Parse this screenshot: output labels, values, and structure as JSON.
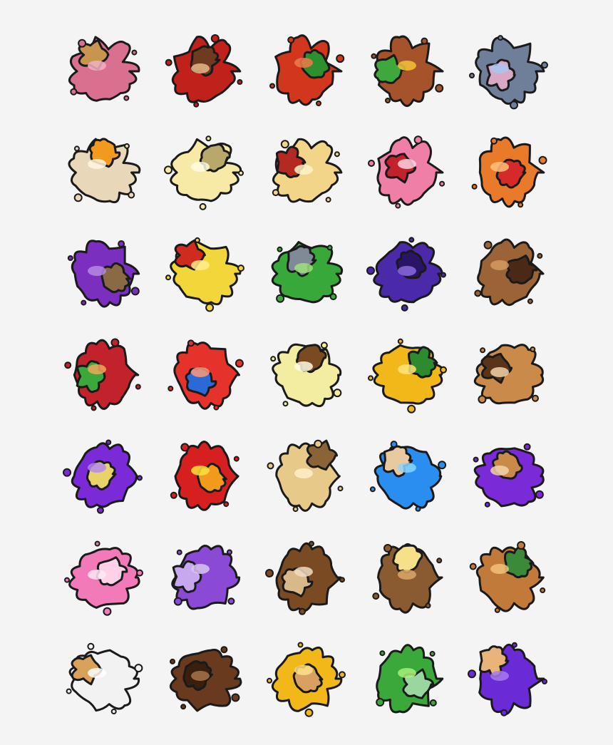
{
  "emotes": [
    {
      "name": "ice-cream-splat-icon",
      "main": "#d9708f",
      "accent": "#c8954e",
      "hl": "#f3b0c3"
    },
    {
      "name": "spaghetti-meatball-splat-icon",
      "main": "#c0211b",
      "accent": "#6e3b1e",
      "hl": "#e8b98a"
    },
    {
      "name": "tomato-splat-icon",
      "main": "#d2371d",
      "accent": "#2e8f2e",
      "hl": "#f07a4a"
    },
    {
      "name": "hamburger-splat-icon",
      "main": "#a6522a",
      "accent": "#3fa83c",
      "hl": "#f6c23a"
    },
    {
      "name": "toaster-jelly-splat-icon",
      "main": "#6f7f9a",
      "accent": "#d9a8c4",
      "hl": "#a9c6ee"
    },
    {
      "name": "cracked-egg-splat-icon",
      "main": "#e8d7b8",
      "accent": "#f29a1d",
      "hl": "#fff6df"
    },
    {
      "name": "popcorn-splat-icon",
      "main": "#f6eaa6",
      "accent": "#b9a86b",
      "hl": "#fffbe0"
    },
    {
      "name": "noodle-bowl-splat-icon",
      "main": "#f3d58a",
      "accent": "#b22a22",
      "hl": "#fff2c7"
    },
    {
      "name": "cake-slice-splat-icon",
      "main": "#ef7fa6",
      "accent": "#c2222b",
      "hl": "#ffd1e1"
    },
    {
      "name": "chips-bag-splat-icon",
      "main": "#e87a2a",
      "accent": "#d42a2a",
      "hl": "#ffc27a"
    },
    {
      "name": "berry-pie-splat-icon",
      "main": "#7b2fbf",
      "accent": "#8a6a45",
      "hl": "#b58ae0"
    },
    {
      "name": "pizza-slice-splat-icon",
      "main": "#f2d63a",
      "accent": "#d12b1f",
      "hl": "#fff08a"
    },
    {
      "name": "salad-plate-splat-icon",
      "main": "#39a83a",
      "accent": "#7f8a96",
      "hl": "#9fe07a"
    },
    {
      "name": "blackberry-splat-icon",
      "main": "#4a2aa8",
      "accent": "#2a1466",
      "hl": "#8a6ae0"
    },
    {
      "name": "cookie-crumbs-icon",
      "main": "#9a6436",
      "accent": "#4a2a16",
      "hl": "#d39a62"
    },
    {
      "name": "fruit-bowl-splat-icon",
      "main": "#c2222b",
      "accent": "#3aa83a",
      "hl": "#f2a85a"
    },
    {
      "name": "cereal-bowl-splat-icon",
      "main": "#e5322b",
      "accent": "#2a6ad6",
      "hl": "#ff9a7a"
    },
    {
      "name": "pudding-splat-icon",
      "main": "#f2eda0",
      "accent": "#7a4a22",
      "hl": "#fffbe0"
    },
    {
      "name": "nachos-splat-icon",
      "main": "#f2b81a",
      "accent": "#2e8a2e",
      "hl": "#ffe37a"
    },
    {
      "name": "smores-splat-icon",
      "main": "#c98a4a",
      "accent": "#5a3418",
      "hl": "#f2d4a8"
    },
    {
      "name": "grape-juice-splat-icon",
      "main": "#7a2ad6",
      "accent": "#e8d36a",
      "hl": "#b588f0"
    },
    {
      "name": "hot-pepper-icon",
      "main": "#d61f1f",
      "accent": "#f29a1a",
      "hl": "#ffe23a"
    },
    {
      "name": "french-fries-splat-icon",
      "main": "#e7c98a",
      "accent": "#8a6436",
      "hl": "#fff0c8"
    },
    {
      "name": "popsicle-splat-icon",
      "main": "#2a8ef0",
      "accent": "#e8c9a0",
      "hl": "#8ad6ff"
    },
    {
      "name": "pbj-sandwich-splat-icon",
      "main": "#7a2ad6",
      "accent": "#c98a4a",
      "hl": "#f2d4a8"
    },
    {
      "name": "cotton-candy-splat-icon",
      "main": "#f27ab8",
      "accent": "#ffd1e9",
      "hl": "#ffe8f4"
    },
    {
      "name": "purple-cup-splat-icon",
      "main": "#8a4ad6",
      "accent": "#c7a8ef",
      "hl": "#d9c4f5"
    },
    {
      "name": "soda-can-splat-icon",
      "main": "#7a4a22",
      "accent": "#d9b88a",
      "hl": "#f0dcc0"
    },
    {
      "name": "pancake-stack-splat-icon",
      "main": "#8a5a30",
      "accent": "#f6e08a",
      "hl": "#d9a86a"
    },
    {
      "name": "sub-sandwich-splat-icon",
      "main": "#c27a3a",
      "accent": "#3a8a3a",
      "hl": "#f2c27a"
    },
    {
      "name": "donut-splat-icon",
      "main": "#f2f2f2",
      "accent": "#d9a25a",
      "hl": "#ffffff"
    },
    {
      "name": "chocolate-pudding-splat-icon",
      "main": "#6a3a1e",
      "accent": "#3a1e0e",
      "hl": "#a8744a"
    },
    {
      "name": "cheese-toast-splat-icon",
      "main": "#f2b81a",
      "accent": "#d9a062",
      "hl": "#ffe08a"
    },
    {
      "name": "green-drink-splat-icon",
      "main": "#3aa83a",
      "accent": "#9ad6a0",
      "hl": "#a8f07a"
    },
    {
      "name": "purple-jello-splat-icon",
      "main": "#6a2ad6",
      "accent": "#e8b47a",
      "hl": "#a87af0"
    }
  ]
}
